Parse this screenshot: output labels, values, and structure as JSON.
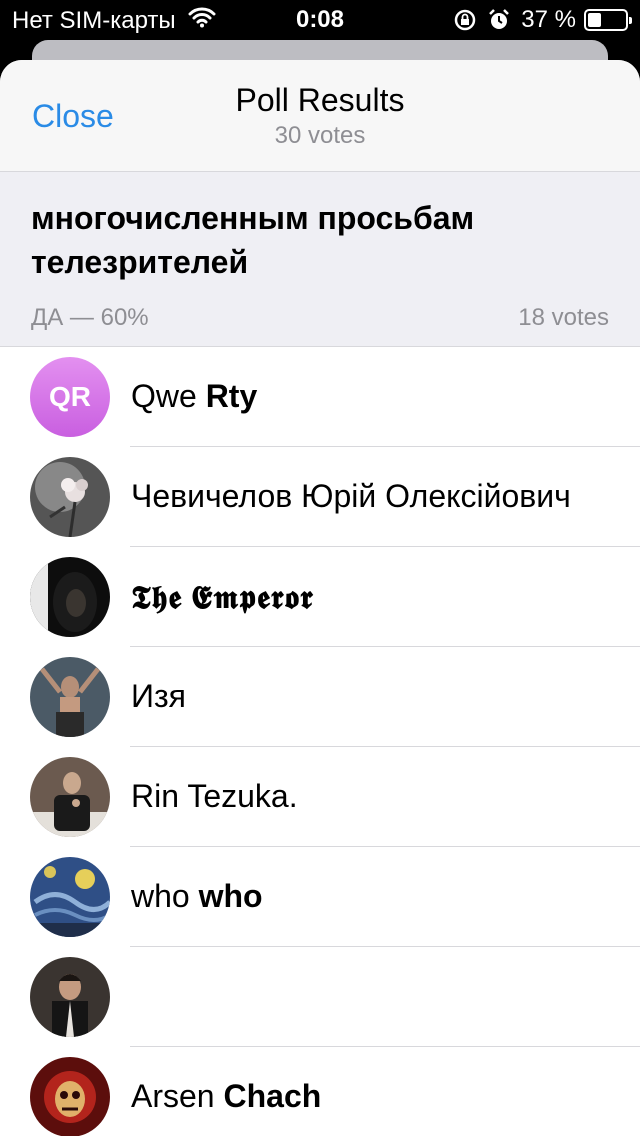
{
  "status_bar": {
    "carrier": "Нет SIM-карты",
    "time": "0:08",
    "battery_text": "37 %",
    "battery_level": 0.37,
    "icons": [
      "wifi-icon",
      "rotation-lock-icon",
      "alarm-icon",
      "battery-icon"
    ]
  },
  "header": {
    "close_label": "Close",
    "title": "Poll Results",
    "subtitle": "30 votes"
  },
  "question": {
    "text_line1": "многочисленным просьбам",
    "text_line2": "телезрителей",
    "option_label": "ДА — 60%",
    "option_votes": "18 votes"
  },
  "voters": [
    {
      "first": "Qwe",
      "last": "Rty",
      "initials": "QR",
      "avatar_color": "#d374e8"
    },
    {
      "first": "Чевичелов",
      "last": "Юрій Олексійович",
      "initials": "",
      "avatar_color": "#6f6f6f"
    },
    {
      "first": "𝕿𝖍𝖊",
      "last": "𝕰𝖒𝖕𝖊𝖗𝖔𝖗",
      "initials": "",
      "avatar_color": "#1c1c1c"
    },
    {
      "first": "Изя",
      "last": "",
      "initials": "",
      "avatar_color": "#3e4a55"
    },
    {
      "first": "Rin",
      "last": "Tezuka.",
      "initials": "",
      "avatar_color": "#5a4a3f"
    },
    {
      "first": "who",
      "last": "who",
      "initials": "",
      "avatar_color": "#3b5c8e"
    },
    {
      "first": "",
      "last": "",
      "initials": "",
      "avatar_color": "#2b2622"
    },
    {
      "first": "Arsen",
      "last": "Chach",
      "initials": "",
      "avatar_color": "#8e1a16"
    }
  ],
  "colors": {
    "accent": "#2a8be6",
    "secondary_text": "#8e8e93",
    "section_bg": "#efeff4"
  }
}
